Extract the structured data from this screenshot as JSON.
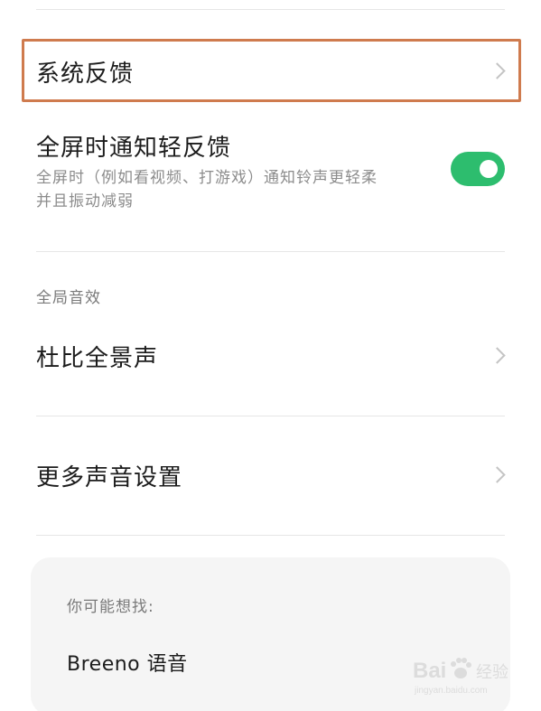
{
  "settings": {
    "system_feedback": "系统反馈",
    "fullscreen_notify_title": "全屏时通知轻反馈",
    "fullscreen_notify_desc_line1": "全屏时（例如看视频、打游戏）通知铃声更轻柔",
    "fullscreen_notify_desc_line2": "并且振动减弱",
    "fullscreen_notify_enabled": true,
    "global_sound_section": "全局音效",
    "dolby_atmos": "杜比全景声",
    "more_sound_settings": "更多声音设置"
  },
  "suggestions": {
    "label": "你可能想找:",
    "item": "Breeno 语音"
  },
  "colors": {
    "toggle_on": "#2dbd6e",
    "highlight_border": "#cf7b4e"
  },
  "watermark": {
    "brand": "Bai",
    "brand_suffix": "经验",
    "url": "jingyan.baidu.com"
  }
}
